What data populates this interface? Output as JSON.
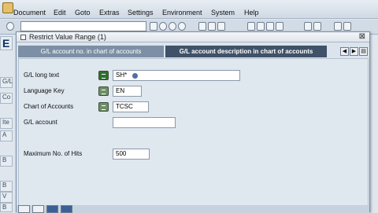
{
  "menu": [
    "Document",
    "Edit",
    "Goto",
    "Extras",
    "Settings",
    "Environment",
    "System",
    "Help"
  ],
  "dialog": {
    "title": "Restrict Value Range (1)",
    "close": "⊠",
    "tabs": [
      "G/L account no. in chart of accounts",
      "G/L account description in chart of accounts"
    ],
    "nav": [
      "◀",
      "▶",
      "▤"
    ],
    "fields": [
      {
        "label": "G/L long text",
        "value": "SH*"
      },
      {
        "label": "Language Key",
        "value": "EN"
      },
      {
        "label": "Chart of Accounts",
        "value": "TCSC"
      },
      {
        "label": "G/L account",
        "value": ""
      },
      {
        "label": "Maximum No. of Hits",
        "value": "500"
      }
    ]
  },
  "background": {
    "texts": [
      "E",
      "G/L",
      "Co",
      "Ite",
      "A",
      "B",
      "B",
      "V",
      "B"
    ]
  },
  "icons": [
    "check-icon",
    "search-icon",
    "save-icon",
    "cancel-icon"
  ]
}
